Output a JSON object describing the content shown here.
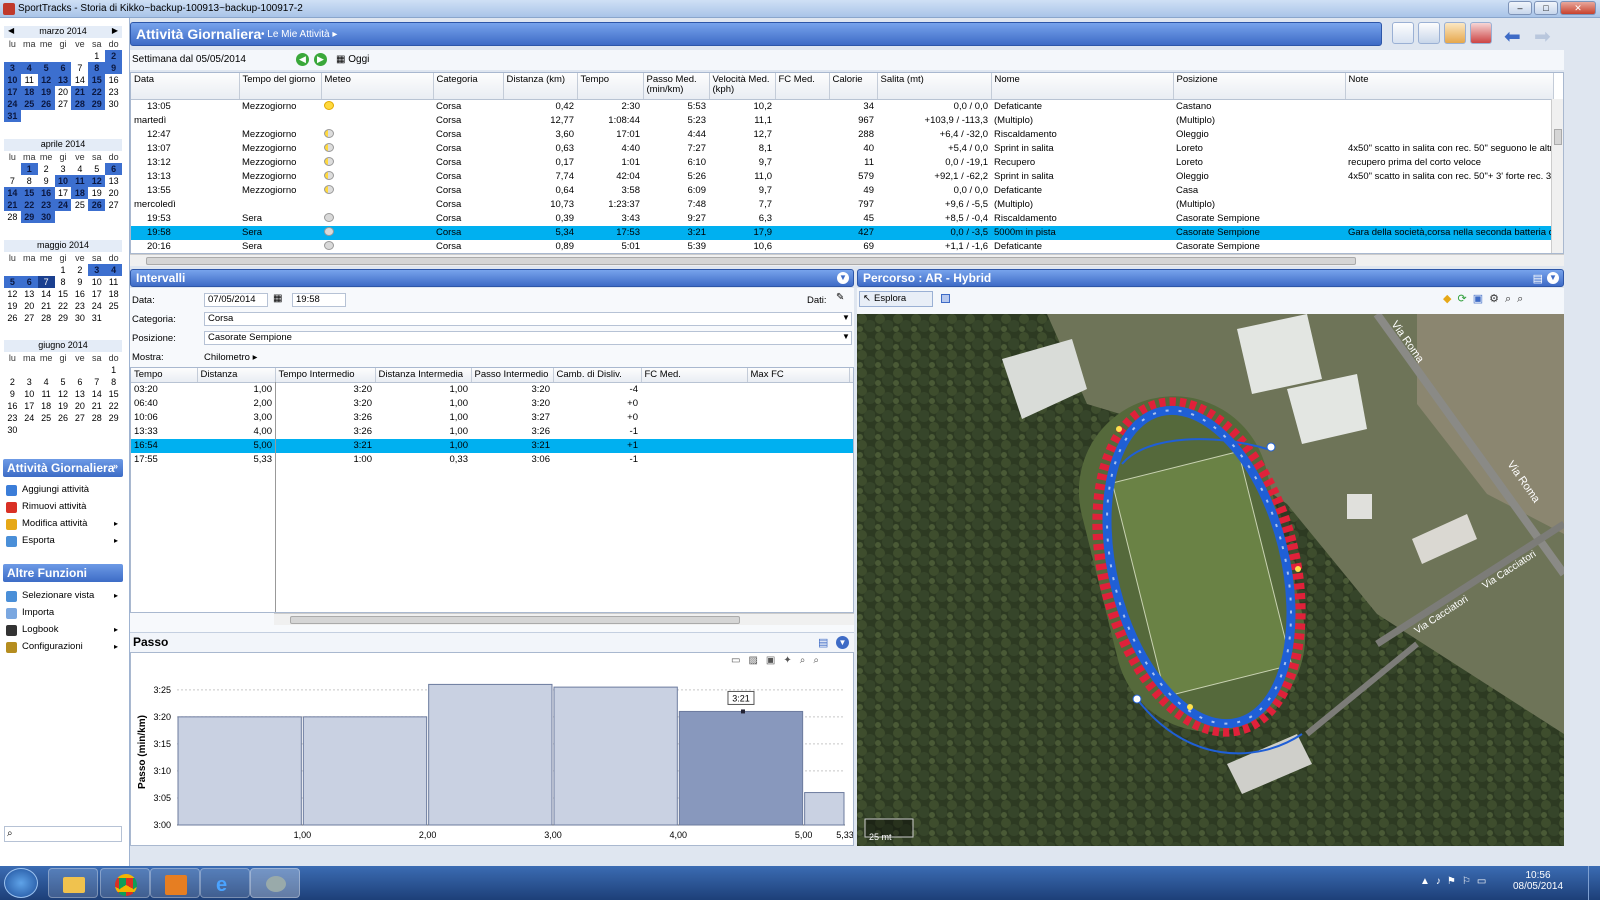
{
  "window": {
    "title": "SportTracks - Storia di Kikko~backup-100913~backup-100917-2"
  },
  "calendars": [
    {
      "month": "marzo 2014",
      "daynames": [
        "lu",
        "ma",
        "me",
        "gi",
        "ve",
        "sa",
        "do"
      ],
      "cells": [
        "",
        "",
        "",
        "",
        "",
        "1",
        "2",
        "3",
        "4",
        "5",
        "6",
        "7",
        "8",
        "9",
        "10",
        "11",
        "12",
        "13",
        "14",
        "15",
        "16",
        "17",
        "18",
        "19",
        "20",
        "21",
        "22",
        "23",
        "24",
        "25",
        "26",
        "27",
        "28",
        "29",
        "30",
        "31"
      ],
      "highlight": [
        "2",
        "3",
        "4",
        "5",
        "6",
        "8",
        "9",
        "10",
        "12",
        "13",
        "15",
        "17",
        "18",
        "19",
        "21",
        "22",
        "24",
        "25",
        "26",
        "28",
        "29",
        "31"
      ]
    },
    {
      "month": "aprile 2014",
      "daynames": [
        "lu",
        "ma",
        "me",
        "gi",
        "ve",
        "sa",
        "do"
      ],
      "cells": [
        "",
        "1",
        "2",
        "3",
        "4",
        "5",
        "6",
        "7",
        "8",
        "9",
        "10",
        "11",
        "12",
        "13",
        "14",
        "15",
        "16",
        "17",
        "18",
        "19",
        "20",
        "21",
        "22",
        "23",
        "24",
        "25",
        "26",
        "27",
        "28",
        "29",
        "30"
      ],
      "highlight": [
        "1",
        "6",
        "10",
        "11",
        "12",
        "14",
        "15",
        "16",
        "18",
        "21",
        "22",
        "23",
        "24",
        "26",
        "29",
        "30"
      ]
    },
    {
      "month": "maggio 2014",
      "daynames": [
        "lu",
        "ma",
        "me",
        "gi",
        "ve",
        "sa",
        "do"
      ],
      "cells": [
        "",
        "",
        "",
        "1",
        "2",
        "3",
        "4",
        "5",
        "6",
        "7",
        "8",
        "9",
        "10",
        "11",
        "12",
        "13",
        "14",
        "15",
        "16",
        "17",
        "18",
        "19",
        "20",
        "21",
        "22",
        "23",
        "24",
        "25",
        "26",
        "27",
        "28",
        "29",
        "30",
        "31"
      ],
      "highlight": [
        "3",
        "4",
        "5",
        "6",
        "7"
      ],
      "selected": "7"
    },
    {
      "month": "giugno 2014",
      "daynames": [
        "lu",
        "ma",
        "me",
        "gi",
        "ve",
        "sa",
        "do"
      ],
      "cells": [
        "",
        "",
        "",
        "",
        "",
        "",
        "1",
        "2",
        "3",
        "4",
        "5",
        "6",
        "7",
        "8",
        "9",
        "10",
        "11",
        "12",
        "13",
        "14",
        "15",
        "16",
        "17",
        "18",
        "19",
        "20",
        "21",
        "22",
        "23",
        "24",
        "25",
        "26",
        "27",
        "28",
        "29",
        "30"
      ],
      "highlight": []
    }
  ],
  "side": {
    "daily_header": "Attività Giornaliera",
    "daily_items": [
      {
        "label": "Aggiungi attività",
        "color": "#3b7dd8"
      },
      {
        "label": "Rimuovi attività",
        "color": "#d93025"
      },
      {
        "label": "Modifica attività",
        "color": "#e6a817"
      },
      {
        "label": "Esporta",
        "color": "#4a8fd8"
      }
    ],
    "other_header": "Altre Funzioni",
    "other_items": [
      {
        "label": "Selezionare vista",
        "color": "#4a8fd8"
      },
      {
        "label": "Importa",
        "color": "#7aa7e0"
      },
      {
        "label": "Logbook",
        "color": "#333"
      },
      {
        "label": "Configurazioni",
        "color": "#b58d1f"
      }
    ]
  },
  "main": {
    "title": "Attività Giornaliera",
    "breadcrumb": "Le Mie Attività",
    "week": "Settimana dal 05/05/2014",
    "today": "Oggi",
    "columns": [
      "Data",
      "Tempo del giorno",
      "Meteo",
      "Categoria",
      "Distanza (km)",
      "Tempo",
      "Passo Med. (min/km)",
      "Velocità Med. (kph)",
      "FC Med.",
      "Calorie",
      "Salita (mt)",
      "Nome",
      "Posizione",
      "Note"
    ],
    "rows": [
      {
        "data": "13:05",
        "tempo_giorno": "Mezzogiorno",
        "meteo": "sun",
        "cat": "Corsa",
        "dist": "0,42",
        "tempo": "2:30",
        "passo": "5:53",
        "vel": "10,2",
        "fc": "",
        "cal": "34",
        "salita": "0,0 / 0,0",
        "nome": "Defaticante",
        "pos": "Castano",
        "note": ""
      },
      {
        "data": "martedì",
        "tempo_giorno": "",
        "meteo": "",
        "cat": "Corsa",
        "dist": "12,77",
        "tempo": "1:08:44",
        "passo": "5:23",
        "vel": "11,1",
        "fc": "",
        "cal": "967",
        "salita": "+103,9 / -113,3",
        "nome": "(Multiplo)",
        "pos": "(Multiplo)",
        "note": "",
        "day": true
      },
      {
        "data": "12:47",
        "tempo_giorno": "Mezzogiorno",
        "meteo": "pc",
        "cat": "Corsa",
        "dist": "3,60",
        "tempo": "17:01",
        "passo": "4:44",
        "vel": "12,7",
        "fc": "",
        "cal": "288",
        "salita": "+6,4 / -32,0",
        "nome": "Riscaldamento",
        "pos": "Oleggio",
        "note": ""
      },
      {
        "data": "13:07",
        "tempo_giorno": "Mezzogiorno",
        "meteo": "pc",
        "cat": "Corsa",
        "dist": "0,63",
        "tempo": "4:40",
        "passo": "7:27",
        "vel": "8,1",
        "fc": "",
        "cal": "40",
        "salita": "+5,4 / 0,0",
        "nome": "Sprint in salita",
        "pos": "Loreto",
        "note": "4x50\" scatto in salita con rec. 50\" seguono le altre"
      },
      {
        "data": "13:12",
        "tempo_giorno": "Mezzogiorno",
        "meteo": "pc",
        "cat": "Corsa",
        "dist": "0,17",
        "tempo": "1:01",
        "passo": "6:10",
        "vel": "9,7",
        "fc": "",
        "cal": "11",
        "salita": "0,0 / -19,1",
        "nome": "Recupero",
        "pos": "Loreto",
        "note": "recupero prima del corto veloce"
      },
      {
        "data": "13:13",
        "tempo_giorno": "Mezzogiorno",
        "meteo": "pc",
        "cat": "Corsa",
        "dist": "7,74",
        "tempo": "42:04",
        "passo": "5:26",
        "vel": "11,0",
        "fc": "",
        "cal": "579",
        "salita": "+92,1 / -62,2",
        "nome": "Sprint in salita",
        "pos": "Oleggio",
        "note": "4x50\" scatto in salita con rec. 50\"+ 3' forte rec. 3' d"
      },
      {
        "data": "13:55",
        "tempo_giorno": "Mezzogiorno",
        "meteo": "pc",
        "cat": "Corsa",
        "dist": "0,64",
        "tempo": "3:58",
        "passo": "6:09",
        "vel": "9,7",
        "fc": "",
        "cal": "49",
        "salita": "0,0 / 0,0",
        "nome": "Defaticante",
        "pos": "Casa",
        "note": ""
      },
      {
        "data": "mercoledì",
        "tempo_giorno": "",
        "meteo": "",
        "cat": "Corsa",
        "dist": "10,73",
        "tempo": "1:23:37",
        "passo": "7:48",
        "vel": "7,7",
        "fc": "",
        "cal": "797",
        "salita": "+9,6 / -5,5",
        "nome": "(Multiplo)",
        "pos": "(Multiplo)",
        "note": "",
        "day": true
      },
      {
        "data": "19:53",
        "tempo_giorno": "Sera",
        "meteo": "cl",
        "cat": "Corsa",
        "dist": "0,39",
        "tempo": "3:43",
        "passo": "9:27",
        "vel": "6,3",
        "fc": "",
        "cal": "45",
        "salita": "+8,5 / -0,4",
        "nome": "Riscaldamento",
        "pos": "Casorate Sempione",
        "note": ""
      },
      {
        "data": "19:58",
        "tempo_giorno": "Sera",
        "meteo": "cl",
        "cat": "Corsa",
        "dist": "5,34",
        "tempo": "17:53",
        "passo": "3:21",
        "vel": "17,9",
        "fc": "",
        "cal": "427",
        "salita": "0,0 / -3,5",
        "nome": "5000m in pista",
        "pos": "Casorate Sempione",
        "note": "Gara della società,corsa nella seconda batteria co",
        "selected": true
      },
      {
        "data": "20:16",
        "tempo_giorno": "Sera",
        "meteo": "cl",
        "cat": "Corsa",
        "dist": "0,89",
        "tempo": "5:01",
        "passo": "5:39",
        "vel": "10,6",
        "fc": "",
        "cal": "69",
        "salita": "+1,1 / -1,6",
        "nome": "Defaticante",
        "pos": "Casorate Sempione",
        "note": ""
      }
    ]
  },
  "intervals": {
    "title": "Intervalli",
    "data_label": "Data:",
    "date": "07/05/2014",
    "time": "19:58",
    "dati_label": "Dati:",
    "categoria_label": "Categoria:",
    "categoria": "Corsa",
    "posizione_label": "Posizione:",
    "posizione": "Casorate Sempione",
    "mostra_label": "Mostra:",
    "mostra": "Chilometro",
    "columns": [
      "Tempo",
      "Distanza",
      "Tempo Intermedio",
      "Distanza Intermedia",
      "Passo Intermedio",
      "Camb. di Disliv.",
      "FC Med.",
      "Max FC",
      "M"
    ],
    "rows": [
      {
        "t": "03:20",
        "d": "1,00",
        "ti": "3:20",
        "di": "1,00",
        "pi": "3:20",
        "cd": "-4"
      },
      {
        "t": "06:40",
        "d": "2,00",
        "ti": "3:20",
        "di": "1,00",
        "pi": "3:20",
        "cd": "+0"
      },
      {
        "t": "10:06",
        "d": "3,00",
        "ti": "3:26",
        "di": "1,00",
        "pi": "3:27",
        "cd": "+0"
      },
      {
        "t": "13:33",
        "d": "4,00",
        "ti": "3:26",
        "di": "1,00",
        "pi": "3:26",
        "cd": "-1"
      },
      {
        "t": "16:54",
        "d": "5,00",
        "ti": "3:21",
        "di": "1,00",
        "pi": "3:21",
        "cd": "+1",
        "selected": true
      },
      {
        "t": "17:55",
        "d": "5,33",
        "ti": "1:00",
        "di": "0,33",
        "pi": "3:06",
        "cd": "-1"
      }
    ]
  },
  "passo": {
    "title": "Passo"
  },
  "chart_data": {
    "type": "bar",
    "title": "",
    "ylabel": "Passo (min/km)",
    "categories": [
      "1,00",
      "2,00",
      "3,00",
      "4,00",
      "5,00",
      "5,33"
    ],
    "values": [
      200,
      200,
      206,
      205.5,
      201,
      186
    ],
    "widths": [
      1,
      1,
      1,
      1,
      1,
      0.33
    ],
    "ytick_labels": [
      "3:00",
      "3:05",
      "3:10",
      "3:15",
      "3:20",
      "3:25"
    ],
    "yticks": [
      180,
      185,
      190,
      195,
      200,
      205
    ],
    "ylim": [
      180,
      207
    ],
    "highlight_index": 4,
    "highlight_label": "3:21",
    "grid": true
  },
  "map": {
    "title": "Percorso  : AR - Hybrid",
    "explore": "Esplora",
    "roads": [
      "Via Roma",
      "Via Roma",
      "Via Cacciatori",
      "Via Cacciatori"
    ],
    "scale": "25 mt"
  },
  "taskbar": {
    "time": "10:56",
    "date": "08/05/2014"
  },
  "colors": {
    "accent": "#3e6bc6",
    "selection": "#00b0f0",
    "route_red": "#e0213a",
    "route_blue": "#1f5fd6"
  }
}
